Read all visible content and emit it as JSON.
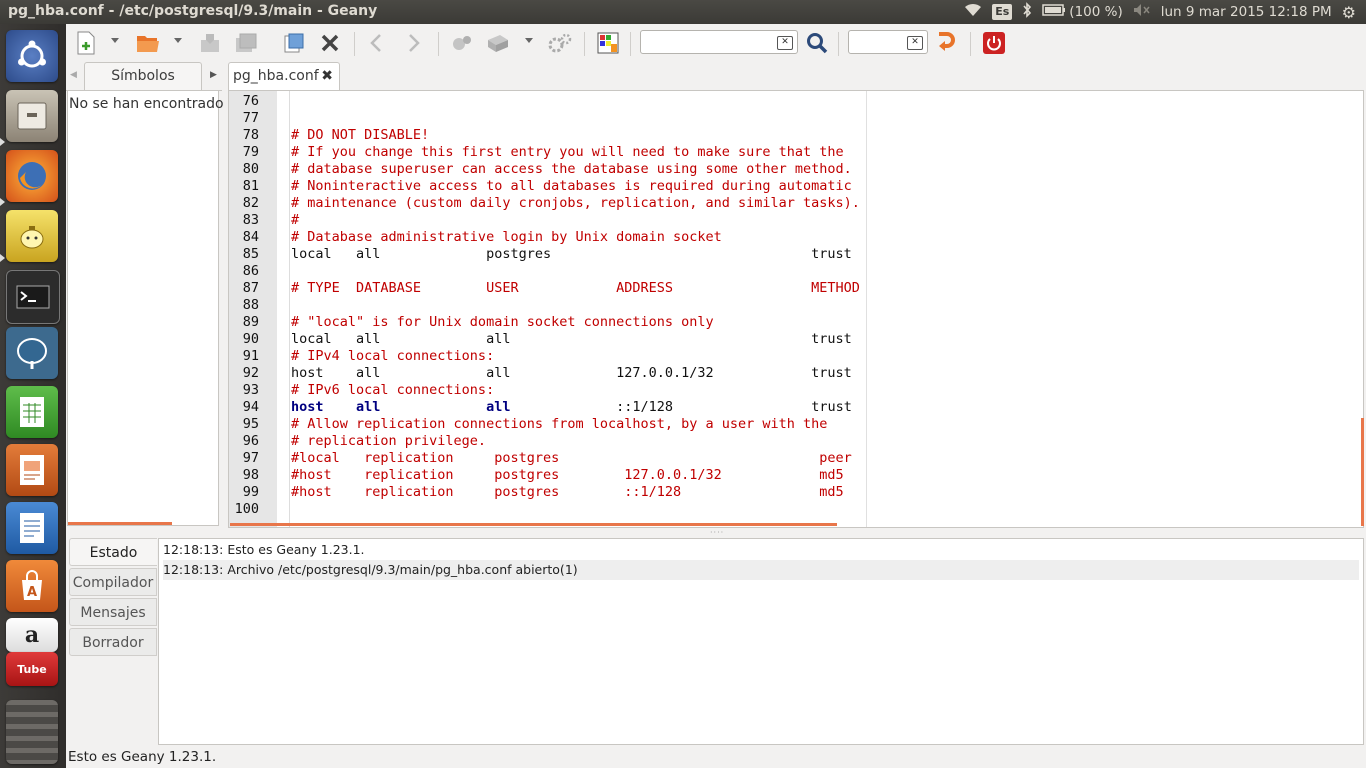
{
  "window": {
    "title": "pg_hba.conf - /etc/postgresql/9.3/main - Geany"
  },
  "panel": {
    "keyboard_layout": "Es",
    "battery": "(100 %)",
    "clock": "lun  9 mar 2015 12:18 PM"
  },
  "launcher": {
    "items": [
      "ubuntu-dash",
      "files",
      "firefox",
      "tea-app",
      "terminal",
      "postgresql",
      "libreoffice-calc",
      "libreoffice-impress",
      "libreoffice-writer",
      "software-center",
      "amazon",
      "youtube",
      "workspaces"
    ]
  },
  "sidebar": {
    "tab_label": "Símbolos",
    "empty_text": "No se han encontrado"
  },
  "editor": {
    "tab_label": "pg_hba.conf",
    "lines": [
      {
        "n": "76",
        "text": "",
        "kind": "plain"
      },
      {
        "n": "77",
        "text": "",
        "kind": "plain"
      },
      {
        "n": "78",
        "text": "# DO NOT DISABLE!",
        "kind": "comment"
      },
      {
        "n": "79",
        "text": "# If you change this first entry you will need to make sure that the",
        "kind": "comment"
      },
      {
        "n": "80",
        "text": "# database superuser can access the database using some other method.",
        "kind": "comment"
      },
      {
        "n": "81",
        "text": "# Noninteractive access to all databases is required during automatic",
        "kind": "comment"
      },
      {
        "n": "82",
        "text": "# maintenance (custom daily cronjobs, replication, and similar tasks).",
        "kind": "comment"
      },
      {
        "n": "83",
        "text": "#",
        "kind": "comment"
      },
      {
        "n": "84",
        "text": "# Database administrative login by Unix domain socket",
        "kind": "comment"
      },
      {
        "n": "85",
        "text": "local   all             postgres                                trust",
        "kind": "plain"
      },
      {
        "n": "86",
        "text": "",
        "kind": "plain"
      },
      {
        "n": "87",
        "text": "# TYPE  DATABASE        USER            ADDRESS                 METHOD",
        "kind": "comment"
      },
      {
        "n": "88",
        "text": "",
        "kind": "plain"
      },
      {
        "n": "89",
        "text": "# \"local\" is for Unix domain socket connections only",
        "kind": "comment"
      },
      {
        "n": "90",
        "text": "local   all             all                                     trust",
        "kind": "plain"
      },
      {
        "n": "91",
        "text": "# IPv4 local connections:",
        "kind": "comment"
      },
      {
        "n": "92",
        "text": "host    all             all             127.0.0.1/32            trust",
        "kind": "plain"
      },
      {
        "n": "93",
        "text": "# IPv6 local connections:",
        "kind": "comment"
      },
      {
        "n": "94",
        "text": "",
        "kind": "keywords",
        "k1": "host",
        "s1": "    ",
        "k2": "all",
        "s2": "             ",
        "k3": "all",
        "rest": "             ::1/128                 trust"
      },
      {
        "n": "95",
        "text": "# Allow replication connections from localhost, by a user with the",
        "kind": "comment"
      },
      {
        "n": "96",
        "text": "# replication privilege.",
        "kind": "comment"
      },
      {
        "n": "97",
        "text": "#local   replication     postgres                                peer",
        "kind": "comment"
      },
      {
        "n": "98",
        "text": "#host    replication     postgres        127.0.0.1/32            md5",
        "kind": "comment"
      },
      {
        "n": "99",
        "text": "#host    replication     postgres        ::1/128                 md5",
        "kind": "comment"
      },
      {
        "n": "100",
        "text": "",
        "kind": "plain"
      }
    ]
  },
  "messages": {
    "tabs": [
      "Estado",
      "Compilador",
      "Mensajes",
      "Borrador"
    ],
    "active_tab": "Estado",
    "rows": [
      "12:18:13: Esto es Geany 1.23.1.",
      "12:18:13: Archivo /etc/postgresql/9.3/main/pg_hba.conf abierto(1)"
    ]
  },
  "statusbar": {
    "text": "Esto es Geany 1.23.1."
  },
  "colors": {
    "accent": "#e8764a",
    "comment": "#c00000",
    "keyword": "#000080"
  }
}
